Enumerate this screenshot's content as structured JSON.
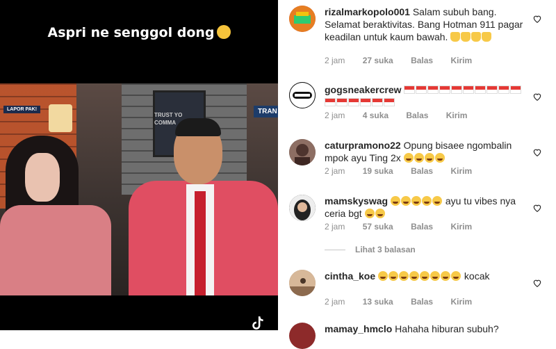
{
  "video": {
    "caption": "Aspri ne senggol dong",
    "caption_emoji": "sweat-smile-emoji",
    "badge_left": "LAPOR PAK!",
    "badge_right": "TRAN",
    "sign_text_1": "TRUST YO",
    "sign_text_2": "COMMA"
  },
  "comments": [
    {
      "user": "rizalmarkopolo001",
      "text": "Salam subuh bang. Selamat beraktivitas. Bang Hotman 911 pagar keadilan untuk kaum bawah.",
      "emoji_tail": "thumbs-up x4",
      "time": "2 jam",
      "likes": "27 suka",
      "reply": "Balas",
      "send": "Kirim",
      "avatar_color": "#c0392b"
    },
    {
      "user": "gogsneakercrew",
      "text": "",
      "emoji_tail": "indonesia-flag x15",
      "time": "2 jam",
      "likes": "4 suka",
      "reply": "Balas",
      "send": "Kirim",
      "avatar_color": "#111111"
    },
    {
      "user": "caturpramono22",
      "text": "Opung bisaee ngombalin mpok ayu Ting 2x",
      "emoji_tail": "laughing x4",
      "time": "2 jam",
      "likes": "19 suka",
      "reply": "Balas",
      "send": "Kirim",
      "avatar_color": "#5d4037"
    },
    {
      "user": "mamskyswag",
      "text": "ayu tu vibes nya ceria bgt",
      "emoji_tail": "laughing",
      "time": "2 jam",
      "likes": "57 suka",
      "reply": "Balas",
      "send": "Kirim",
      "avatar_color": "#3e3e3e"
    },
    {
      "user": "cintha_koe",
      "text": "kocak",
      "emoji_tail": "laughing x8",
      "time": "2 jam",
      "likes": "13 suka",
      "reply": "Balas",
      "send": "Kirim",
      "avatar_color": "#b08a6a"
    },
    {
      "user": "mamay_hmclo",
      "text": "Hahaha hiburan subuh?",
      "time": "",
      "likes": "",
      "avatar_color": "#8d2a2a"
    }
  ],
  "view_replies": "Lihat 3 balasan"
}
